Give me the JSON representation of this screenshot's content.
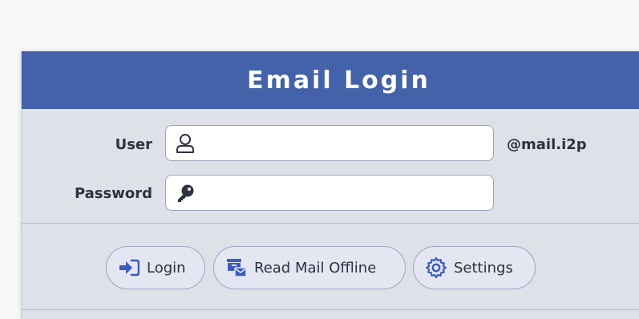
{
  "header": {
    "title": "Email Login"
  },
  "form": {
    "user_label": "User",
    "user_value": "",
    "user_suffix": "@mail.i2p",
    "password_label": "Password",
    "password_value": ""
  },
  "icons": {
    "user": "user-outline-icon",
    "password": "key-icon",
    "login": "sign-in-icon",
    "offline": "mail-archive-icon",
    "settings": "gear-icon"
  },
  "buttons": {
    "login": "Login",
    "offline": "Read Mail Offline",
    "settings": "Settings"
  },
  "colors": {
    "header_bg": "#4462a9",
    "accent": "#3a5bbf"
  }
}
